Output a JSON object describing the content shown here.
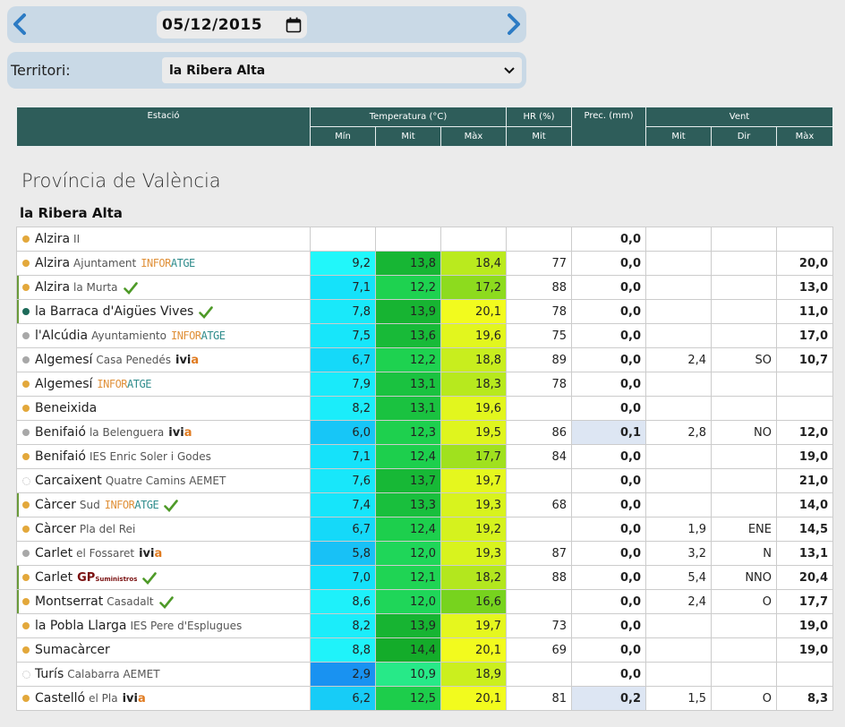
{
  "date": {
    "value": "05/12/2015"
  },
  "territory": {
    "label": "Territori:",
    "value": "la Ribera Alta"
  },
  "header": {
    "station": "Estació",
    "temperature": "Temperatura (°C)",
    "hr": "HR (%)",
    "prec": "Prec. (mm)",
    "wind": "Vent",
    "t_min": "Mín",
    "t_mit": "Mit",
    "t_max": "Màx",
    "hr_mit": "Mit",
    "w_mit": "Mit",
    "w_dir": "Dir",
    "w_max": "Màx"
  },
  "province": "Província de València",
  "region": "la Ribera Alta",
  "brand": {
    "infor": "INFOR",
    "atge": "ATGE",
    "ivi": "ivi",
    "a": "a",
    "gp": "GP",
    "gp_small": "Suministros"
  },
  "colors": {
    "header_bg": "#2e5d5a",
    "info_orange": "#e0913a",
    "info_teal": "#2f8c8c",
    "ivia_orange": "#e07b20",
    "check_green": "#4e9a28"
  },
  "rows": [
    {
      "name": "Alzira",
      "sub": "II",
      "tag": "",
      "dot": "#e3a83b",
      "dot_style": "solid",
      "marked": false,
      "check": false,
      "tmin": "",
      "tmit": "",
      "tmax": "",
      "hr": "",
      "prec": "0,0",
      "wmit": "",
      "wdir": "",
      "wmax": ""
    },
    {
      "name": "Alzira",
      "sub": "Ajuntament",
      "tag": "infor",
      "dot": "#e3a83b",
      "dot_style": "solid",
      "marked": false,
      "check": false,
      "tmin": "9,2",
      "tmit": "13,8",
      "tmax": "18,4",
      "hr": "77",
      "prec": "0,0",
      "wmit": "",
      "wdir": "",
      "wmax": "20,0"
    },
    {
      "name": "Alzira",
      "sub": "la Murta",
      "tag": "",
      "dot": "#e3a83b",
      "dot_style": "solid",
      "marked": true,
      "check": true,
      "tmin": "7,1",
      "tmit": "12,2",
      "tmax": "17,2",
      "hr": "88",
      "prec": "0,0",
      "wmit": "",
      "wdir": "",
      "wmax": "13,0"
    },
    {
      "name": "la Barraca d'Aigües Vives",
      "sub": "",
      "tag": "",
      "dot": "#1e6b5a",
      "dot_style": "solid",
      "marked": true,
      "check": true,
      "tmin": "7,8",
      "tmit": "13,9",
      "tmax": "20,1",
      "hr": "78",
      "prec": "0,0",
      "wmit": "",
      "wdir": "",
      "wmax": "11,0"
    },
    {
      "name": "l'Alcúdia",
      "sub": "Ayuntamiento",
      "tag": "infor",
      "dot": "#a8a8a8",
      "dot_style": "solid",
      "marked": false,
      "check": false,
      "tmin": "7,5",
      "tmit": "13,6",
      "tmax": "19,6",
      "hr": "75",
      "prec": "0,0",
      "wmit": "",
      "wdir": "",
      "wmax": "17,0"
    },
    {
      "name": "Algemesí",
      "sub": "Casa Penedés",
      "tag": "ivia",
      "dot": "#a8a8a8",
      "dot_style": "solid",
      "marked": false,
      "check": false,
      "tmin": "6,7",
      "tmit": "12,2",
      "tmax": "18,8",
      "hr": "89",
      "prec": "0,0",
      "wmit": "2,4",
      "wdir": "SO",
      "wmax": "10,7"
    },
    {
      "name": "Algemesí",
      "sub": "",
      "tag": "infor",
      "dot": "#e3a83b",
      "dot_style": "solid",
      "marked": false,
      "check": false,
      "tmin": "7,9",
      "tmit": "13,1",
      "tmax": "18,3",
      "hr": "78",
      "prec": "0,0",
      "wmit": "",
      "wdir": "",
      "wmax": ""
    },
    {
      "name": "Beneixida",
      "sub": "",
      "tag": "",
      "dot": "#e3a83b",
      "dot_style": "solid",
      "marked": false,
      "check": false,
      "tmin": "8,2",
      "tmit": "13,1",
      "tmax": "19,6",
      "hr": "",
      "prec": "0,0",
      "wmit": "",
      "wdir": "",
      "wmax": ""
    },
    {
      "name": "Benifaió",
      "sub": "la Belenguera",
      "tag": "ivia",
      "dot": "#a8a8a8",
      "dot_style": "solid",
      "marked": false,
      "check": false,
      "tmin": "6,0",
      "tmit": "12,3",
      "tmax": "19,5",
      "hr": "86",
      "prec": "0,1",
      "wmit": "2,8",
      "wdir": "NO",
      "wmax": "12,0"
    },
    {
      "name": "Benifaió",
      "sub": "IES Enric Soler i Godes",
      "tag": "",
      "dot": "#e3a83b",
      "dot_style": "solid",
      "marked": false,
      "check": false,
      "tmin": "7,1",
      "tmit": "12,4",
      "tmax": "17,7",
      "hr": "84",
      "prec": "0,0",
      "wmit": "",
      "wdir": "",
      "wmax": "19,0"
    },
    {
      "name": "Carcaixent",
      "sub": "Quatre Camins AEMET",
      "tag": "",
      "dot": "#bbbbbb",
      "dot_style": "dotted",
      "marked": false,
      "check": false,
      "tmin": "7,6",
      "tmit": "13,7",
      "tmax": "19,7",
      "hr": "",
      "prec": "0,0",
      "wmit": "",
      "wdir": "",
      "wmax": "21,0"
    },
    {
      "name": "Càrcer",
      "sub": "Sud",
      "tag": "infor",
      "dot": "#e3a83b",
      "dot_style": "solid",
      "marked": true,
      "check": true,
      "tmin": "7,4",
      "tmit": "13,3",
      "tmax": "19,3",
      "hr": "68",
      "prec": "0,0",
      "wmit": "",
      "wdir": "",
      "wmax": "14,0"
    },
    {
      "name": "Càrcer",
      "sub": "Pla del Rei",
      "tag": "",
      "dot": "#e3a83b",
      "dot_style": "solid",
      "marked": false,
      "check": false,
      "tmin": "6,7",
      "tmit": "12,4",
      "tmax": "19,2",
      "hr": "",
      "prec": "0,0",
      "wmit": "1,9",
      "wdir": "ENE",
      "wmax": "14,5"
    },
    {
      "name": "Carlet",
      "sub": "el Fossaret",
      "tag": "ivia",
      "dot": "#a8a8a8",
      "dot_style": "solid",
      "marked": false,
      "check": false,
      "tmin": "5,8",
      "tmit": "12,0",
      "tmax": "19,3",
      "hr": "87",
      "prec": "0,0",
      "wmit": "3,2",
      "wdir": "N",
      "wmax": "13,1"
    },
    {
      "name": "Carlet",
      "sub": "",
      "tag": "gp",
      "dot": "#e3a83b",
      "dot_style": "solid",
      "marked": true,
      "check": true,
      "tmin": "7,0",
      "tmit": "12,1",
      "tmax": "18,2",
      "hr": "88",
      "prec": "0,0",
      "wmit": "5,4",
      "wdir": "NNO",
      "wmax": "20,4"
    },
    {
      "name": "Montserrat",
      "sub": "Casadalt",
      "tag": "",
      "dot": "#e3a83b",
      "dot_style": "solid",
      "marked": true,
      "check": true,
      "tmin": "8,6",
      "tmit": "12,0",
      "tmax": "16,6",
      "hr": "",
      "prec": "0,0",
      "wmit": "2,4",
      "wdir": "O",
      "wmax": "17,7"
    },
    {
      "name": "la Pobla Llarga",
      "sub": "IES Pere d'Esplugues",
      "tag": "",
      "dot": "#e3a83b",
      "dot_style": "solid",
      "marked": false,
      "check": false,
      "tmin": "8,2",
      "tmit": "13,9",
      "tmax": "19,7",
      "hr": "73",
      "prec": "0,0",
      "wmit": "",
      "wdir": "",
      "wmax": "19,0"
    },
    {
      "name": "Sumacàrcer",
      "sub": "",
      "tag": "",
      "dot": "#e3a83b",
      "dot_style": "solid",
      "marked": false,
      "check": false,
      "tmin": "8,8",
      "tmit": "14,4",
      "tmax": "20,1",
      "hr": "69",
      "prec": "0,0",
      "wmit": "",
      "wdir": "",
      "wmax": "19,0"
    },
    {
      "name": "Turís",
      "sub": "Calabarra AEMET",
      "tag": "",
      "dot": "#bbbbbb",
      "dot_style": "dotted",
      "marked": false,
      "check": false,
      "tmin": "2,9",
      "tmit": "10,9",
      "tmax": "18,9",
      "hr": "",
      "prec": "0,0",
      "wmit": "",
      "wdir": "",
      "wmax": ""
    },
    {
      "name": "Castelló",
      "sub": "el Pla",
      "tag": "ivia",
      "dot": "#e3a83b",
      "dot_style": "solid",
      "marked": false,
      "check": false,
      "tmin": "6,2",
      "tmit": "12,5",
      "tmax": "20,1",
      "hr": "81",
      "prec": "0,2",
      "wmit": "1,5",
      "wdir": "O",
      "wmax": "8,3"
    }
  ]
}
